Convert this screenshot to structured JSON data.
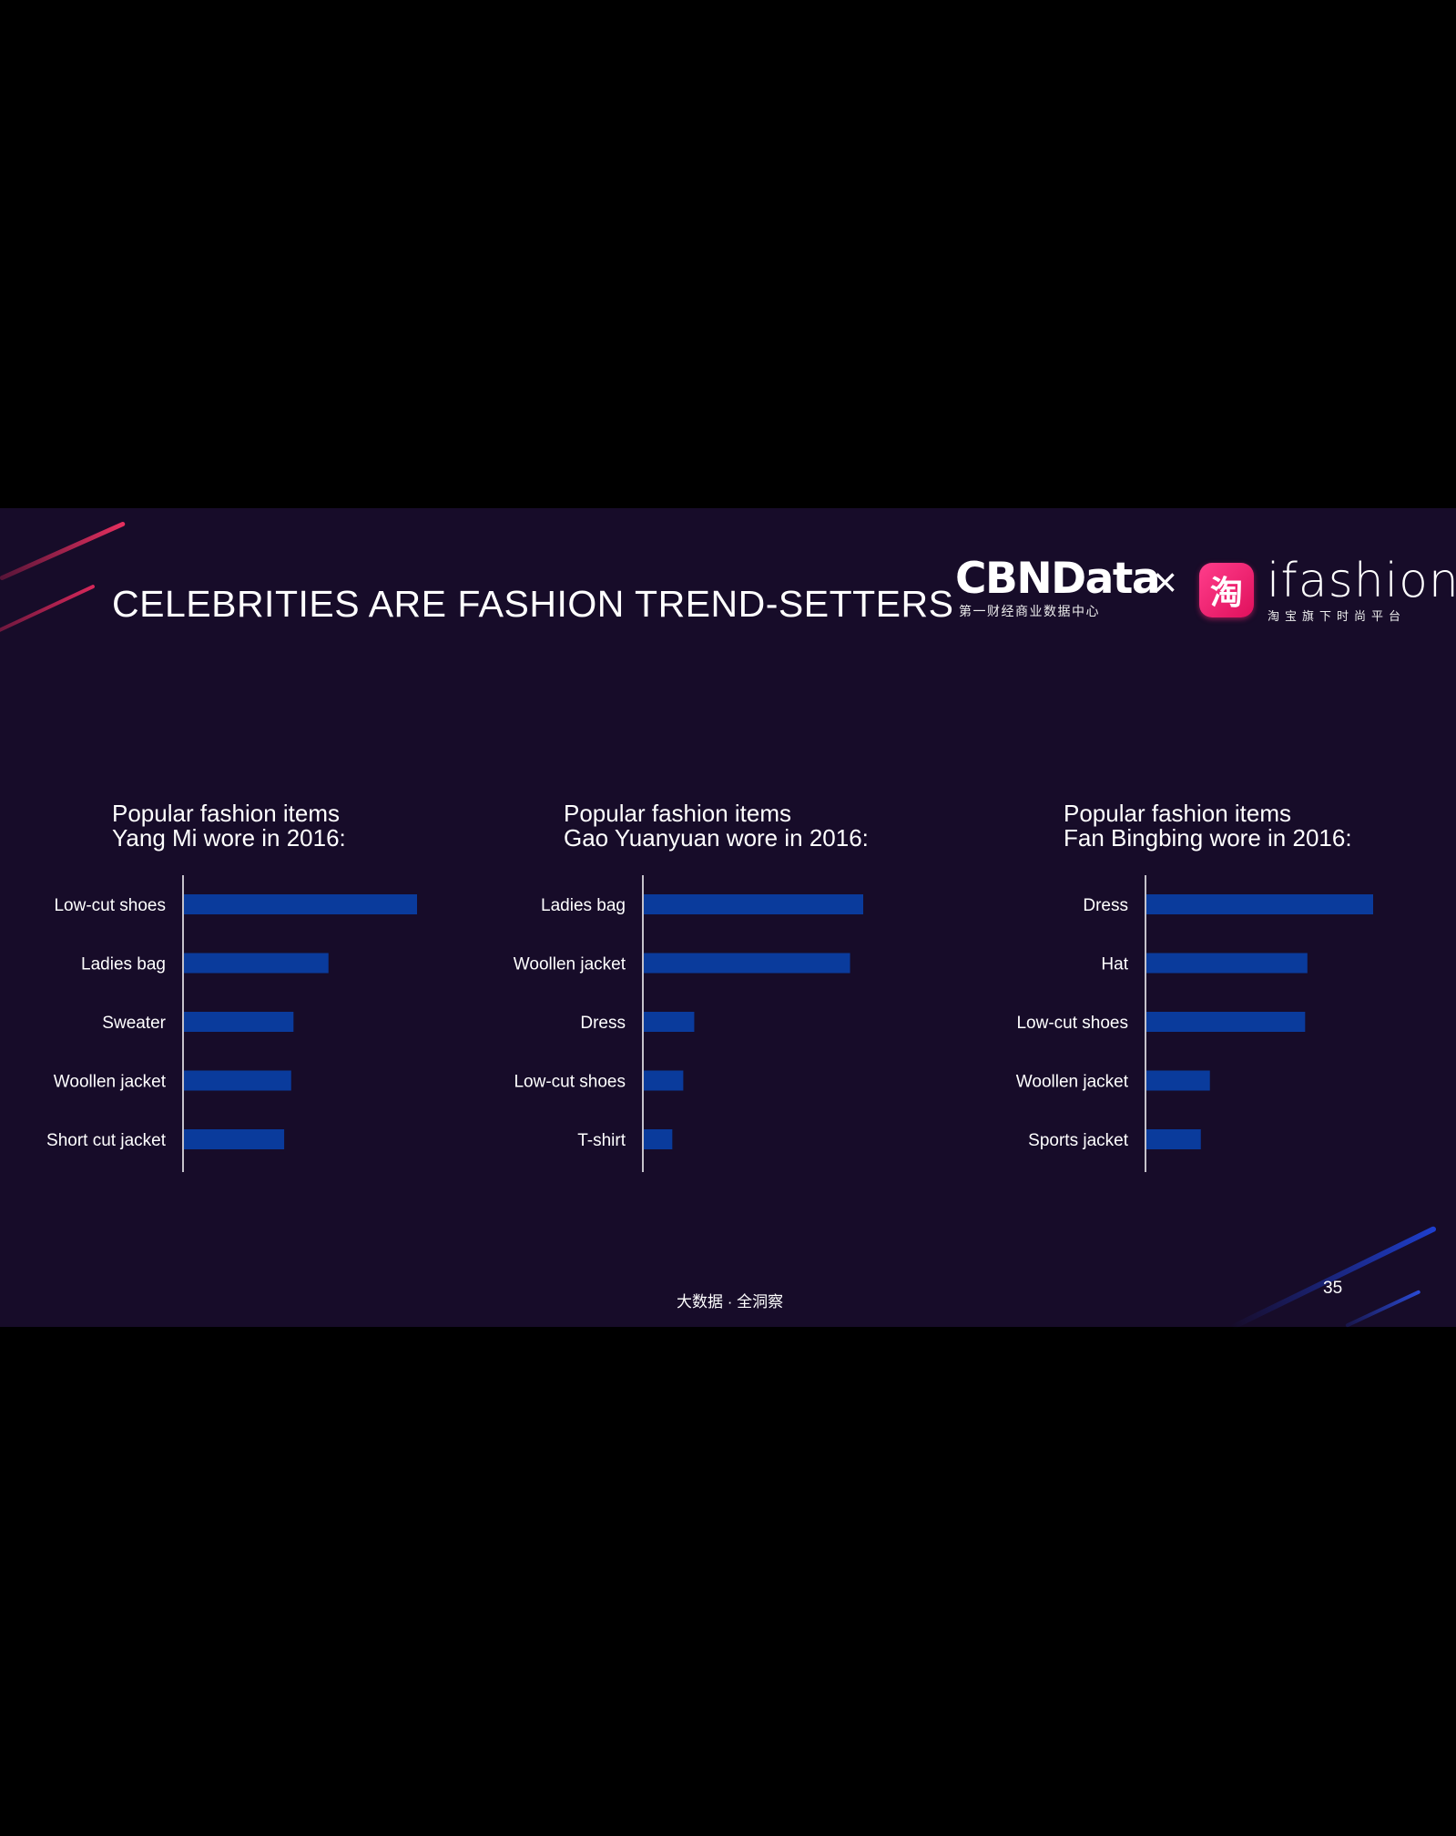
{
  "slide": {
    "title": "CELEBRITIES ARE FASHION TREND-SETTERS",
    "background_color": "#170c29",
    "bar_color": "#0a3b9c",
    "footer": "大数据 · 全洞察",
    "page_number": "35"
  },
  "logos": {
    "cbndata_name": "CBNData",
    "cbndata_tagline": "第一财经商业数据中心",
    "cross": "×",
    "taobao_glyph": "淘",
    "ifashion_name": "ifashion",
    "ifashion_tagline": "淘宝旗下时尚平台"
  },
  "chart_data": [
    {
      "type": "bar",
      "orientation": "horizontal",
      "title_line1": "Popular fashion items",
      "title_line2": "Yang Mi wore in 2016:",
      "categories": [
        "Low-cut shoes",
        "Ladies bag",
        "Sweater",
        "Woollen jacket",
        "Short cut jacket"
      ],
      "values": [
        100,
        62,
        47,
        46,
        43
      ],
      "value_axis_shown": false
    },
    {
      "type": "bar",
      "orientation": "horizontal",
      "title_line1": "Popular fashion items",
      "title_line2": "Gao Yuanyuan wore in 2016:",
      "categories": [
        "Ladies bag",
        "Woollen jacket",
        "Dress",
        "Low-cut shoes",
        "T-shirt"
      ],
      "values": [
        100,
        94,
        23,
        18,
        13
      ],
      "value_axis_shown": false
    },
    {
      "type": "bar",
      "orientation": "horizontal",
      "title_line1": "Popular fashion items",
      "title_line2": "Fan Bingbing wore in 2016:",
      "categories": [
        "Dress",
        "Hat",
        "Low-cut shoes",
        "Woollen jacket",
        "Sports jacket"
      ],
      "values": [
        100,
        71,
        70,
        28,
        24
      ],
      "value_axis_shown": false
    }
  ]
}
